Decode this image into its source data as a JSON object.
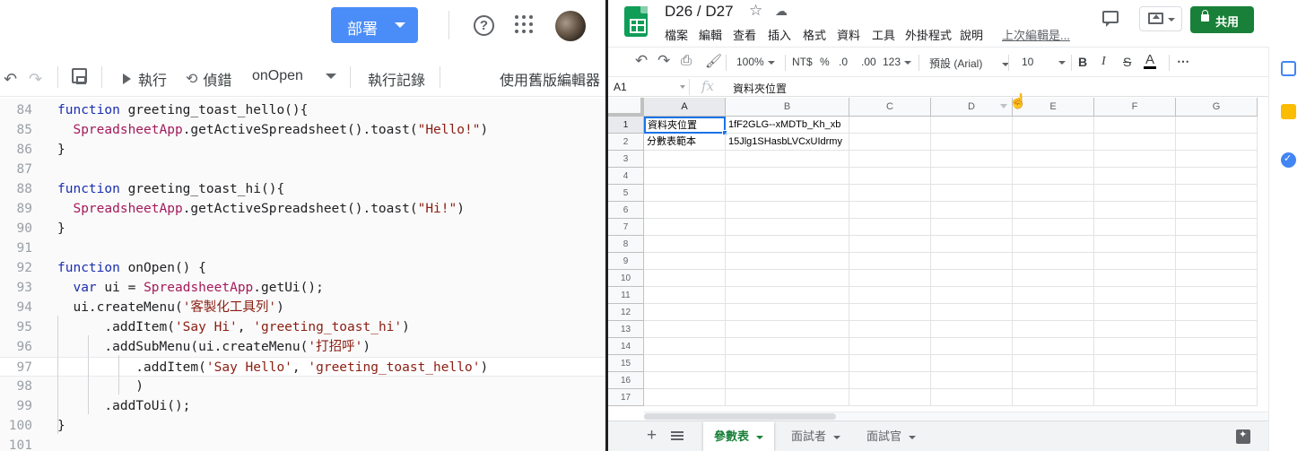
{
  "editor": {
    "deploy_label": "部署",
    "toolbar": {
      "run_label": "執行",
      "debug_label": "偵錯",
      "function_name": "onOpen",
      "log_label": "執行記錄",
      "legacy_label": "使用舊版編輯器"
    },
    "code_lines": [
      {
        "n": "84",
        "html": "<span class=\"kw\">function</span> greeting_toast_hello(){"
      },
      {
        "n": "85",
        "html": "  <span class=\"cls\">SpreadsheetApp</span>.getActiveSpreadsheet().toast(<span class=\"str\">\"Hello!\"</span>)"
      },
      {
        "n": "86",
        "html": "}"
      },
      {
        "n": "87",
        "html": ""
      },
      {
        "n": "88",
        "html": "<span class=\"kw\">function</span> greeting_toast_hi(){"
      },
      {
        "n": "89",
        "html": "  <span class=\"cls\">SpreadsheetApp</span>.getActiveSpreadsheet().toast(<span class=\"str\">\"Hi!\"</span>)"
      },
      {
        "n": "90",
        "html": "}"
      },
      {
        "n": "91",
        "html": ""
      },
      {
        "n": "92",
        "html": "<span class=\"kw\">function</span> onOpen() {"
      },
      {
        "n": "93",
        "html": "  <span class=\"kw\">var</span> ui = <span class=\"cls\">SpreadsheetApp</span>.getUi();"
      },
      {
        "n": "94",
        "html": "  ui.createMenu(<span class=\"str\">'客製化工具列'</span>)"
      },
      {
        "n": "95",
        "html": "      .addItem(<span class=\"str\">'Say Hi'</span>, <span class=\"str\">'greeting_toast_hi'</span>)"
      },
      {
        "n": "96",
        "html": "      .addSubMenu(ui.createMenu(<span class=\"str\">'打招呼'</span>)"
      },
      {
        "n": "97",
        "html": "          .addItem(<span class=\"str\">'Say Hello'</span>, <span class=\"str\">'greeting_toast_hello'</span>)"
      },
      {
        "n": "98",
        "html": "          )"
      },
      {
        "n": "99",
        "html": "      .addToUi();"
      },
      {
        "n": "100",
        "html": "}"
      },
      {
        "n": "101",
        "html": ""
      }
    ]
  },
  "sheets": {
    "title": "D26 / D27",
    "menu": [
      "檔案",
      "編輯",
      "查看",
      "插入",
      "格式",
      "資料",
      "工具",
      "外掛程式",
      "說明"
    ],
    "last_edit": "上次編輯是...",
    "share_label": "共用",
    "toolbar": {
      "zoom": "100%",
      "currency": "NT$",
      "percent": "%",
      "dec_decrease": ".0",
      "dec_increase": ".00",
      "more_formats": "123",
      "font": "預設 (Arial)",
      "font_size": "10",
      "bold": "B",
      "italic": "I",
      "strike": "S",
      "text_color": "A",
      "more": "⋯"
    },
    "formula_bar": {
      "ref": "A1",
      "fx": "fx",
      "value": "資料夾位置"
    },
    "columns": [
      "A",
      "B",
      "C",
      "D",
      "E",
      "F",
      "G"
    ],
    "rows": [
      "1",
      "2",
      "3",
      "4",
      "5",
      "6",
      "7",
      "8",
      "9",
      "10",
      "11",
      "12",
      "13",
      "14",
      "15",
      "16",
      "17"
    ],
    "cells": {
      "A1": "資料夾位置",
      "B1": "1fF2GLG--xMDTb_Kh_xb",
      "A2": "分數表範本",
      "B2": "15Jlg1SHasbLVCxUIdrmy"
    },
    "tabs": [
      "參數表",
      "面試者",
      "面試官"
    ],
    "colors": {
      "sheets_green": "#188038",
      "selection_blue": "#1a73e8",
      "deploy_blue": "#4b8df8"
    }
  }
}
